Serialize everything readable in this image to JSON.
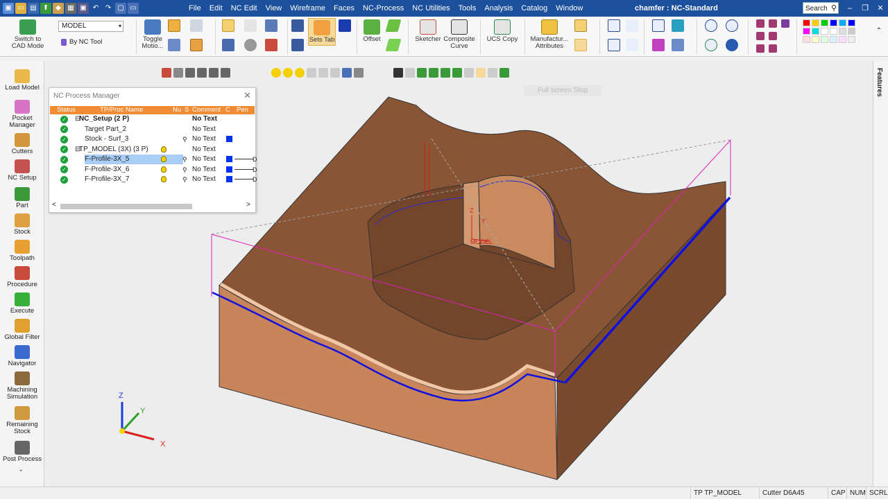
{
  "window": {
    "title": "chamfer : NC-Standard",
    "search_label": "Search",
    "minimize": "–",
    "restore": "❐",
    "close": "✕"
  },
  "menu": [
    "File",
    "Edit",
    "NC Edit",
    "View",
    "Wireframe",
    "Faces",
    "NC-Process",
    "NC Utilities",
    "Tools",
    "Analysis",
    "Catalog",
    "Window"
  ],
  "ribbon": {
    "switch_cad_line1": "Switch to",
    "switch_cad_line2": "CAD Mode",
    "model_combo": "MODEL",
    "by_nc_tool": "By NC Tool",
    "toggle_motion_line1": "Toggle",
    "toggle_motion_line2": "Motio...",
    "sets_tab": "Sets Tab",
    "offset": "Offset",
    "sketcher": "Sketcher",
    "composite_curve_line1": "Composite",
    "composite_curve_line2": "Curve",
    "ucs_copy": "UCS Copy",
    "manufacturing_line1": "Manufactur...",
    "manufacturing_line2": "Attributes"
  },
  "palette": [
    "#ff0000",
    "#ffcc00",
    "#00cc00",
    "#0000ff",
    "#00aaff",
    "#0000ff",
    "#ff00ff",
    "#00dddd",
    "#ffffff",
    "#ffffff",
    "#dddddd",
    "#cccccc",
    "#ffdddd",
    "#ffffcc",
    "#ddffdd",
    "#ddeeff",
    "#ffddff",
    "#eeeeee"
  ],
  "left_nav": [
    {
      "line1": "Load Model",
      "line2": "",
      "icon": "load-model-icon",
      "color": "#e8b84a"
    },
    {
      "line1": "Pocket",
      "line2": "Manager",
      "icon": "pocket-manager-icon",
      "color": "#d873c6"
    },
    {
      "line1": "Cutters",
      "line2": "",
      "icon": "cutters-icon",
      "color": "#d2963c"
    },
    {
      "line1": "NC Setup",
      "line2": "",
      "icon": "nc-setup-icon",
      "color": "#c55050"
    },
    {
      "line1": "Part",
      "line2": "",
      "icon": "part-icon",
      "color": "#3a9a3a"
    },
    {
      "line1": "Stock",
      "line2": "",
      "icon": "stock-icon",
      "color": "#e0a040"
    },
    {
      "line1": "Toolpath",
      "line2": "",
      "icon": "toolpath-icon",
      "color": "#e8a030"
    },
    {
      "line1": "Procedure",
      "line2": "",
      "icon": "procedure-icon",
      "color": "#c84a3a"
    },
    {
      "line1": "Execute",
      "line2": "",
      "icon": "execute-icon",
      "color": "#38b038"
    },
    {
      "line1": "Global Filter",
      "line2": "",
      "icon": "global-filter-icon",
      "color": "#e0a030"
    },
    {
      "line1": "Navigator",
      "line2": "",
      "icon": "navigator-icon",
      "color": "#3a6ad0"
    },
    {
      "line1": "Machining",
      "line2": "Simulation",
      "icon": "machining-simulation-icon",
      "color": "#8a6a3a"
    },
    {
      "line1": "Remaining",
      "line2": "Stock",
      "icon": "remaining-stock-icon",
      "color": "#d09a40"
    },
    {
      "line1": "Post Process",
      "line2": "",
      "icon": "post-process-icon",
      "color": "#666666"
    }
  ],
  "left_more": "⌄",
  "right_tab": "Features",
  "viewport": {
    "fullscreen_label": "Full screen Stop"
  },
  "axis": {
    "x": "X",
    "y": "Y",
    "z": "Z"
  },
  "model_axis": {
    "z": "Z",
    "y": "Y",
    "label": "MODEL"
  },
  "process_manager": {
    "title": "NC Process Manager",
    "close": "✕",
    "columns": {
      "status": "Status",
      "name": "TP/Proc Name",
      "num": "Nu",
      "s": "S",
      "comment": "Comment",
      "c": "C",
      "pen": "Pen"
    },
    "rows": [
      {
        "name": "NC_Setup (2 P)",
        "comment": "No Text",
        "bold": true,
        "expander": "⊟",
        "status": "setup",
        "bulb": false,
        "link": false,
        "color": false,
        "pen": false
      },
      {
        "name": "Target Part_2",
        "comment": "No Text",
        "bold": false,
        "expander": "",
        "status": "ok",
        "bulb": false,
        "link": false,
        "color": false,
        "pen": false
      },
      {
        "name": "Stock - Surf_3",
        "comment": "No Text",
        "bold": false,
        "expander": "",
        "status": "ok",
        "bulb": false,
        "link": true,
        "color": true,
        "pen": false
      },
      {
        "name": "TP_MODEL (3X) (3 P)",
        "comment": "No Text",
        "bold": false,
        "expander": "⊟",
        "status": "ok",
        "bulb": true,
        "link": false,
        "color": false,
        "pen": false
      },
      {
        "name": "F-Profile-3X_5",
        "comment": "No Text",
        "bold": false,
        "expander": "",
        "status": "ok",
        "bulb": true,
        "link": true,
        "color": true,
        "pen": true,
        "selected": true
      },
      {
        "name": "F-Profile-3X_6",
        "comment": "No Text",
        "bold": false,
        "expander": "",
        "status": "ok",
        "bulb": true,
        "link": true,
        "color": true,
        "pen": true
      },
      {
        "name": "F-Profile-3X_7",
        "comment": "No Text",
        "bold": false,
        "expander": "",
        "status": "ok",
        "bulb": true,
        "link": true,
        "color": true,
        "pen": true
      }
    ],
    "pen_suffix": "D",
    "scroll_left": "<",
    "scroll_right": ">"
  },
  "status": {
    "tp": "TP  TP_MODEL",
    "cutter": "Cutter  D6A45",
    "cap": "CAP",
    "num": "NUM",
    "scrl": "SCRL"
  }
}
